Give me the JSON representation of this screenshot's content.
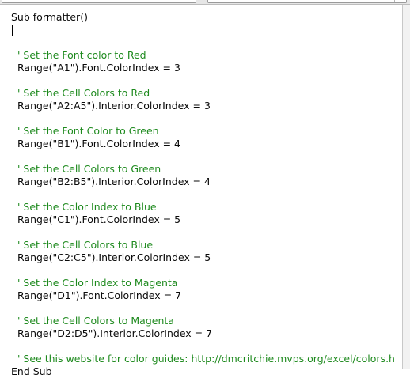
{
  "editor": {
    "lines": [
      {
        "text": "Sub formatter()",
        "kind": "code",
        "indent": false
      },
      {
        "text": "",
        "kind": "caret",
        "indent": false
      },
      {
        "text": "",
        "kind": "blank",
        "indent": false
      },
      {
        "text": "' Set the Font color to Red",
        "kind": "comment",
        "indent": true
      },
      {
        "text": "Range(\"A1\").Font.ColorIndex = 3",
        "kind": "code",
        "indent": true
      },
      {
        "text": "",
        "kind": "blank",
        "indent": false
      },
      {
        "text": "' Set the Cell Colors to Red",
        "kind": "comment",
        "indent": true
      },
      {
        "text": "Range(\"A2:A5\").Interior.ColorIndex = 3",
        "kind": "code",
        "indent": true
      },
      {
        "text": "",
        "kind": "blank",
        "indent": false
      },
      {
        "text": "' Set the Font Color to Green",
        "kind": "comment",
        "indent": true
      },
      {
        "text": "Range(\"B1\").Font.ColorIndex = 4",
        "kind": "code",
        "indent": true
      },
      {
        "text": "",
        "kind": "blank",
        "indent": false
      },
      {
        "text": "' Set the Cell Colors to Green",
        "kind": "comment",
        "indent": true
      },
      {
        "text": "Range(\"B2:B5\").Interior.ColorIndex = 4",
        "kind": "code",
        "indent": true
      },
      {
        "text": "",
        "kind": "blank",
        "indent": false
      },
      {
        "text": "' Set the Color Index to Blue",
        "kind": "comment",
        "indent": true
      },
      {
        "text": "Range(\"C1\").Font.ColorIndex = 5",
        "kind": "code",
        "indent": true
      },
      {
        "text": "",
        "kind": "blank",
        "indent": false
      },
      {
        "text": "' Set the Cell Colors to Blue",
        "kind": "comment",
        "indent": true
      },
      {
        "text": "Range(\"C2:C5\").Interior.ColorIndex = 5",
        "kind": "code",
        "indent": true
      },
      {
        "text": "",
        "kind": "blank",
        "indent": false
      },
      {
        "text": "' Set the Color Index to Magenta",
        "kind": "comment",
        "indent": true
      },
      {
        "text": "Range(\"D1\").Font.ColorIndex = 7",
        "kind": "code",
        "indent": true
      },
      {
        "text": "",
        "kind": "blank",
        "indent": false
      },
      {
        "text": "' Set the Cell Colors to Magenta",
        "kind": "comment",
        "indent": true
      },
      {
        "text": "Range(\"D2:D5\").Interior.ColorIndex = 7",
        "kind": "code",
        "indent": true
      },
      {
        "text": "",
        "kind": "blank",
        "indent": false
      },
      {
        "text": "' See this website for color guides: http://dmcritchie.mvps.org/excel/colors.h",
        "kind": "comment",
        "indent": true
      },
      {
        "text": "End Sub",
        "kind": "code",
        "indent": false
      }
    ]
  },
  "colors": {
    "code": "#0a0a0a",
    "comment": "#1e8a1e",
    "background": "#ffffff"
  }
}
